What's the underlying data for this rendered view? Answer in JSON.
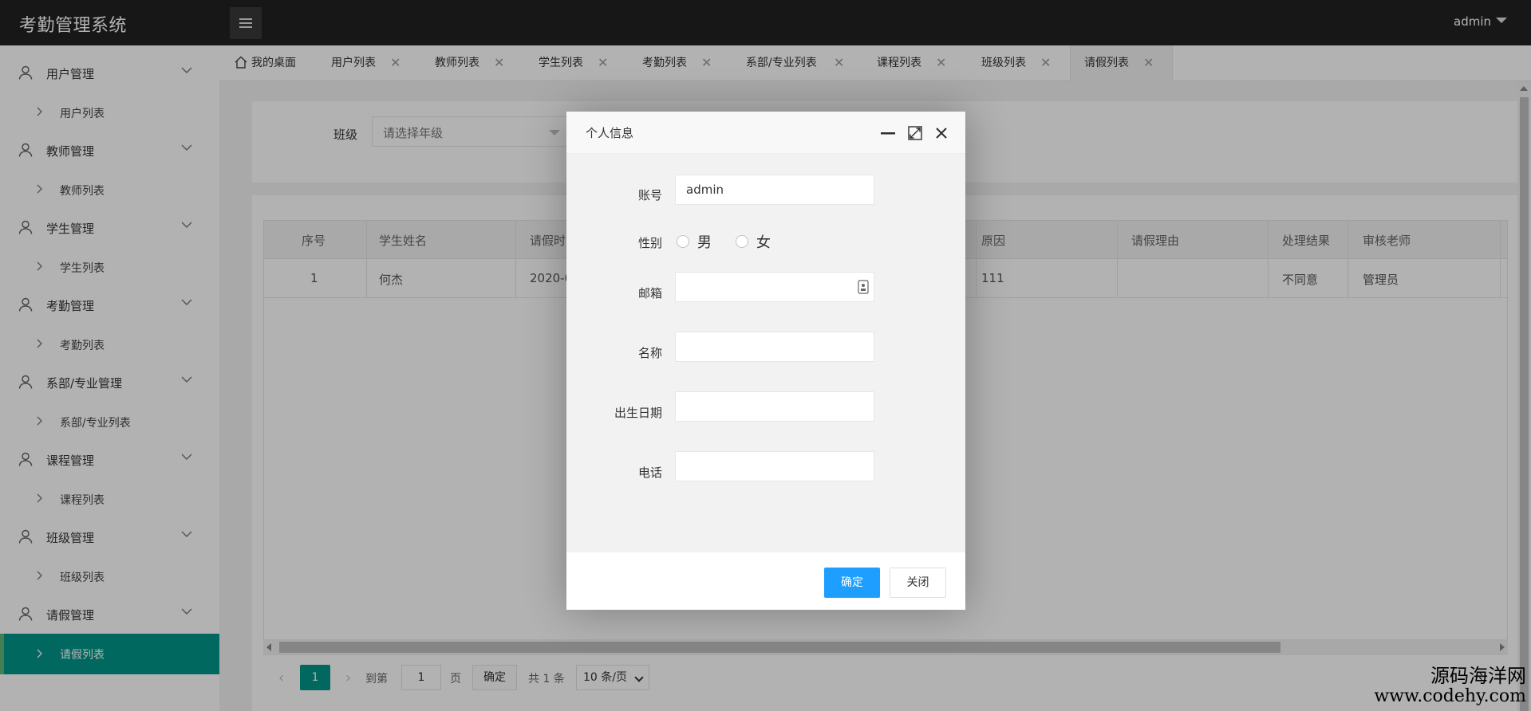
{
  "header": {
    "title": "考勤管理系统",
    "user": "admin"
  },
  "sidebar": {
    "groups": [
      {
        "label": "用户管理",
        "sub": "用户列表"
      },
      {
        "label": "教师管理",
        "sub": "教师列表"
      },
      {
        "label": "学生管理",
        "sub": "学生列表"
      },
      {
        "label": "考勤管理",
        "sub": "考勤列表"
      },
      {
        "label": "系部/专业管理",
        "sub": "系部/专业列表"
      },
      {
        "label": "课程管理",
        "sub": "课程列表"
      },
      {
        "label": "班级管理",
        "sub": "班级列表"
      },
      {
        "label": "请假管理",
        "sub": "请假列表"
      }
    ]
  },
  "tabs": [
    {
      "label": "我的桌面"
    },
    {
      "label": "用户列表"
    },
    {
      "label": "教师列表"
    },
    {
      "label": "学生列表"
    },
    {
      "label": "考勤列表"
    },
    {
      "label": "系部/专业列表"
    },
    {
      "label": "课程列表"
    },
    {
      "label": "班级列表"
    },
    {
      "label": "请假列表"
    }
  ],
  "filter": {
    "label": "班级",
    "placeholder": "请选择年级"
  },
  "table": {
    "headers": [
      "序号",
      "学生姓名",
      "请假时",
      "原因",
      "请假理由",
      "处理结果",
      "审核老师"
    ],
    "rows": [
      [
        "1",
        "何杰",
        "2020-0",
        "111",
        "",
        "不同意",
        "管理员"
      ]
    ]
  },
  "pager": {
    "current": "1",
    "goto_label": "到第",
    "page_input": "1",
    "page_suffix": "页",
    "confirm": "确定",
    "total": "共 1 条",
    "size": "10 条/页"
  },
  "modal": {
    "title": "个人信息",
    "fields": {
      "account_label": "账号",
      "account_value": "admin",
      "gender_label": "性别",
      "gender_male": "男",
      "gender_female": "女",
      "email_label": "邮箱",
      "name_label": "名称",
      "birth_label": "出生日期",
      "phone_label": "电话"
    },
    "ok": "确定",
    "close": "关闭"
  },
  "watermark": {
    "line1": "源码海洋网",
    "line2": "www.codehy.com"
  }
}
